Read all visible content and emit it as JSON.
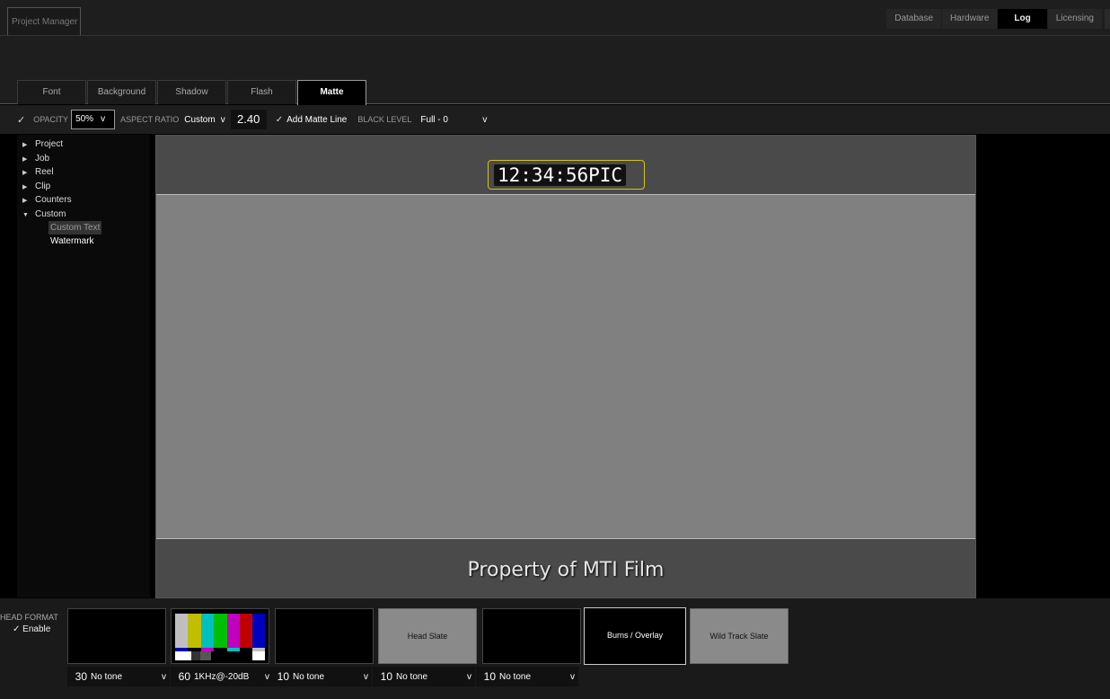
{
  "app_tab": "Project Manager",
  "top_nav": [
    "Database",
    "Hardware",
    "Log",
    "Licensing"
  ],
  "tabs": [
    "Font",
    "Background",
    "Shadow",
    "Flash",
    "Matte"
  ],
  "active_tab": "Matte",
  "options": {
    "opacity_label": "OPACITY",
    "opacity_value": "50%",
    "aspect_label": "ASPECT RATIO",
    "aspect_value": "Custom",
    "aspect_number": "2.40",
    "matte_line_label": "Add Matte Line",
    "black_level_label": "BLACK LEVEL",
    "black_level_value": "Full - 0",
    "check_glyph": "✓",
    "arrow_glyph": "v"
  },
  "tree": {
    "items": [
      "Project",
      "Job",
      "Reel",
      "Clip",
      "Counters",
      "Custom"
    ],
    "children": [
      "Custom Text",
      "Watermark"
    ]
  },
  "preview": {
    "timecode": "12:34:56PIC",
    "watermark": "Property of MTI Film"
  },
  "bottom": {
    "head_format": "HEAD FORMAT",
    "enable": "Enable",
    "slates": [
      "Head Slate",
      "Burns / Overlay",
      "Wild Track Slate"
    ],
    "tones": [
      {
        "num": "30",
        "label": "No tone"
      },
      {
        "num": "60",
        "label": "1KHz@-20dB"
      },
      {
        "num": "10",
        "label": "No tone"
      },
      {
        "num": "10",
        "label": "No tone"
      },
      {
        "num": "10",
        "label": "No tone"
      }
    ]
  },
  "colors": {
    "timecode_border": "#d6c21a",
    "preview_bg": "#808080",
    "matte_bg": "#4a4a4a"
  }
}
